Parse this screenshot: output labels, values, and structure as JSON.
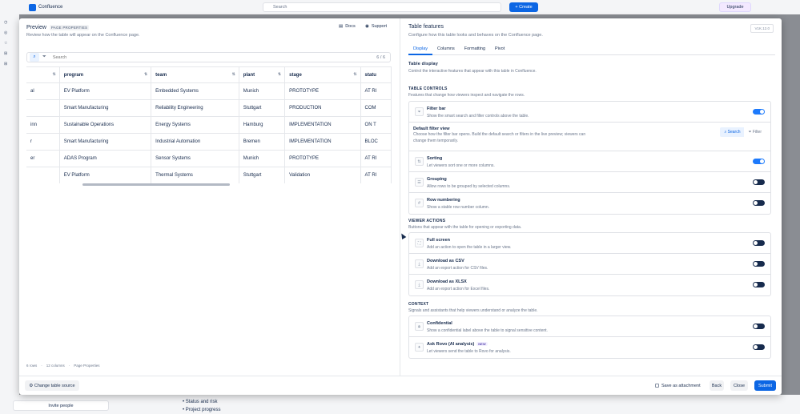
{
  "app": {
    "name": "Confluence",
    "search_placeholder": "Search",
    "create_label": "+ Create",
    "upgrade_label": "Upgrade",
    "invite_label": "Invite people",
    "page_bullets": [
      "Status and risk",
      "Project progress"
    ]
  },
  "preview": {
    "title": "Preview",
    "badge": "PAGE PROPERTIES",
    "subtitle": "Review how the table will appear on the Confluence page.",
    "docs_label": "Docs",
    "support_label": "Support",
    "search_placeholder": "Search",
    "count": "6 / 6",
    "columns": [
      "",
      "program",
      "team",
      "plant",
      "stage",
      "statu"
    ],
    "rows": [
      [
        "al",
        "EV Platform",
        "Embedded Systems",
        "Munich",
        "PROTOTYPE",
        "AT RI"
      ],
      [
        "",
        "Smart Manufacturing",
        "Reliability Engineering",
        "Stuttgart",
        "PRODUCTION",
        "COM"
      ],
      [
        "inn",
        "Sustainable Operations",
        "Energy Systems",
        "Hamburg",
        "IMPLEMENTATION",
        "ON T"
      ],
      [
        "r",
        "Smart Manufacturing",
        "Industrial Automation",
        "Bremen",
        "IMPLEMENTATION",
        "BLOC"
      ],
      [
        "er",
        "ADAS Program",
        "Sensor Systems",
        "Munich",
        "PROTOTYPE",
        "AT RI"
      ],
      [
        "",
        "EV Platform",
        "Thermal Systems",
        "Stuttgart",
        "Validation",
        "AT RI"
      ]
    ],
    "meta": [
      "6 rows",
      "·",
      "12 columns",
      "·",
      "Page Properties"
    ]
  },
  "features": {
    "title": "Table features",
    "subtitle": "Configure how this table looks and behaves on the Confluence page.",
    "version": "V1K.12.0",
    "tabs": [
      "Display",
      "Columns",
      "Formatting",
      "Pivot"
    ],
    "display_h": "Table display",
    "display_d": "Control the interactive features that appear with this table in Confluence.",
    "controls_h": "TABLE CONTROLS",
    "controls_d": "Features that change how viewers inspect and navigate the rows.",
    "filter_bar": {
      "label": "Filter bar",
      "desc": "Show the smart search and filter controls above the table."
    },
    "default_filter": {
      "label": "Default filter view",
      "desc": "Choose how the filter bar opens. Build the default search or filters in the live preview; viewers can change them temporarily.",
      "search": "Search",
      "filter": "Filter"
    },
    "sorting": {
      "label": "Sorting",
      "desc": "Let viewers sort one or more columns."
    },
    "grouping": {
      "label": "Grouping",
      "desc": "Allow rows to be grouped by selected columns."
    },
    "row_numbering": {
      "label": "Row numbering",
      "desc": "Show a stable row number column."
    },
    "viewer_h": "VIEWER ACTIONS",
    "viewer_d": "Buttons that appear with the table for opening or exporting data.",
    "full_screen": {
      "label": "Full screen",
      "desc": "Add an action to open the table in a larger view."
    },
    "csv": {
      "label": "Download as CSV",
      "desc": "Add an export action for CSV files."
    },
    "xlsx": {
      "label": "Download as XLSX",
      "desc": "Add an export action for Excel files."
    },
    "context_h": "CONTEXT",
    "context_d": "Signals and assistants that help viewers understand or analyze the table.",
    "confidential": {
      "label": "Confidential",
      "desc": "Show a confidential label above the table to signal sensitive content."
    },
    "rovo": {
      "label": "Ask Rovo (AI analysis)",
      "badge": "NEW",
      "desc": "Let viewers send the table to Rovo for analysis."
    }
  },
  "footer": {
    "change_source": "Change table source",
    "save_attachment": "Save as attachment",
    "back": "Back",
    "close": "Close",
    "submit": "Submit"
  },
  "colors": {
    "accent": "#0c66e4",
    "toggle_on": "#1d7afc",
    "toggle_off": "#172b4d"
  }
}
